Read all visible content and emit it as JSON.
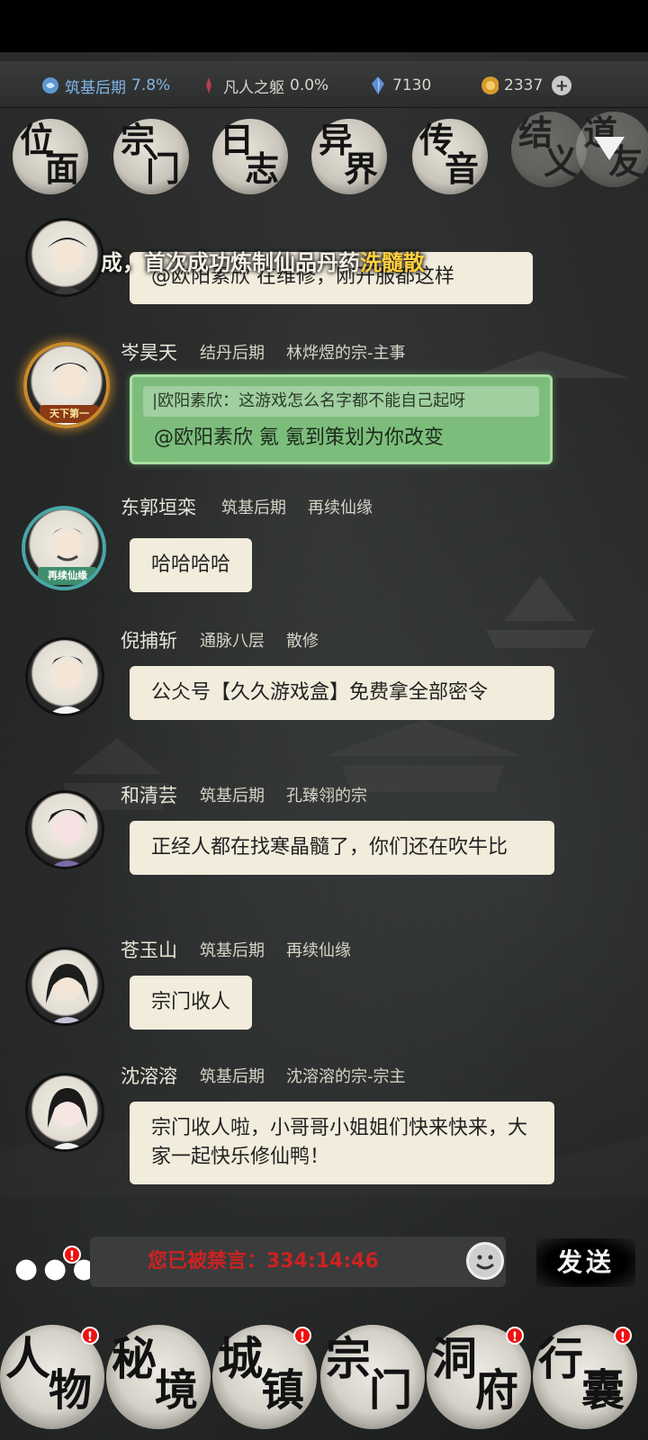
{
  "resources": {
    "realm_name": "筑基后期",
    "realm_pct": "7.8%",
    "body_name": "凡人之躯",
    "body_pct": "0.0%",
    "spirit_stones": "7130",
    "coins": "2337"
  },
  "top_nav": [
    {
      "a": "位",
      "b": "面"
    },
    {
      "a": "宗",
      "b": "门"
    },
    {
      "a": "日",
      "b": "志"
    },
    {
      "a": "异",
      "b": "界"
    },
    {
      "a": "传",
      "b": "音"
    },
    {
      "a": "结",
      "b": "义"
    },
    {
      "a": "道",
      "b": "友"
    }
  ],
  "banner": {
    "text": "成，首次成功炼制仙品丹药",
    "highlight": "洗髓散"
  },
  "messages": [
    {
      "name": "",
      "realm": "",
      "sect": "",
      "quote": "",
      "text": "@欧阳素欣 在维修，刚开服都这样"
    },
    {
      "name": "岑昊天",
      "realm": "结丹后期",
      "sect": "林烨煜的宗-主事",
      "quote": "|欧阳素欣：这游戏怎么名字都不能自己起呀",
      "text": "@欧阳素欣 氪 氪到策划为你改变",
      "badge": "天下第一"
    },
    {
      "name": "东郭垣栾",
      "realm": "筑基后期",
      "sect": "再续仙缘",
      "text": "哈哈哈哈",
      "badge": "再续仙缘"
    },
    {
      "name": "倪捕斩",
      "realm": "通脉八层",
      "sect": "散修",
      "text": "公仌号【久久游戏盒】免费拿全部密令"
    },
    {
      "name": "和清芸",
      "realm": "筑基后期",
      "sect": "孔臻翎的宗",
      "text": "正经人都在找寒晶髓了，你们还在吹牛比"
    },
    {
      "name": "苍玉山",
      "realm": "筑基后期",
      "sect": "再续仙缘",
      "text": "宗门收人"
    },
    {
      "name": "沈溶溶",
      "realm": "筑基后期",
      "sect": "沈溶溶的宗-宗主",
      "text": "宗门收人啦，小哥哥小姐姐们快来快来，大家一起快乐修仙鸭！"
    }
  ],
  "input": {
    "muted_text": "您已被禁言：334:14:46",
    "send_label": "发送"
  },
  "bottom_nav": [
    {
      "a": "人",
      "b": "物",
      "alert": "!"
    },
    {
      "a": "秘",
      "b": "境",
      "alert": ""
    },
    {
      "a": "城",
      "b": "镇",
      "alert": "!"
    },
    {
      "a": "宗",
      "b": "门",
      "alert": ""
    },
    {
      "a": "洞",
      "b": "府",
      "alert": "!"
    },
    {
      "a": "行",
      "b": "囊",
      "alert": "!"
    }
  ],
  "colors": {
    "accent_blue": "#7fb6e8",
    "highlight_gold": "#ffcf3e",
    "muted_red": "#cc2222",
    "bubble": "#f2ecdc",
    "bubble_green": "#7cbd7c"
  }
}
